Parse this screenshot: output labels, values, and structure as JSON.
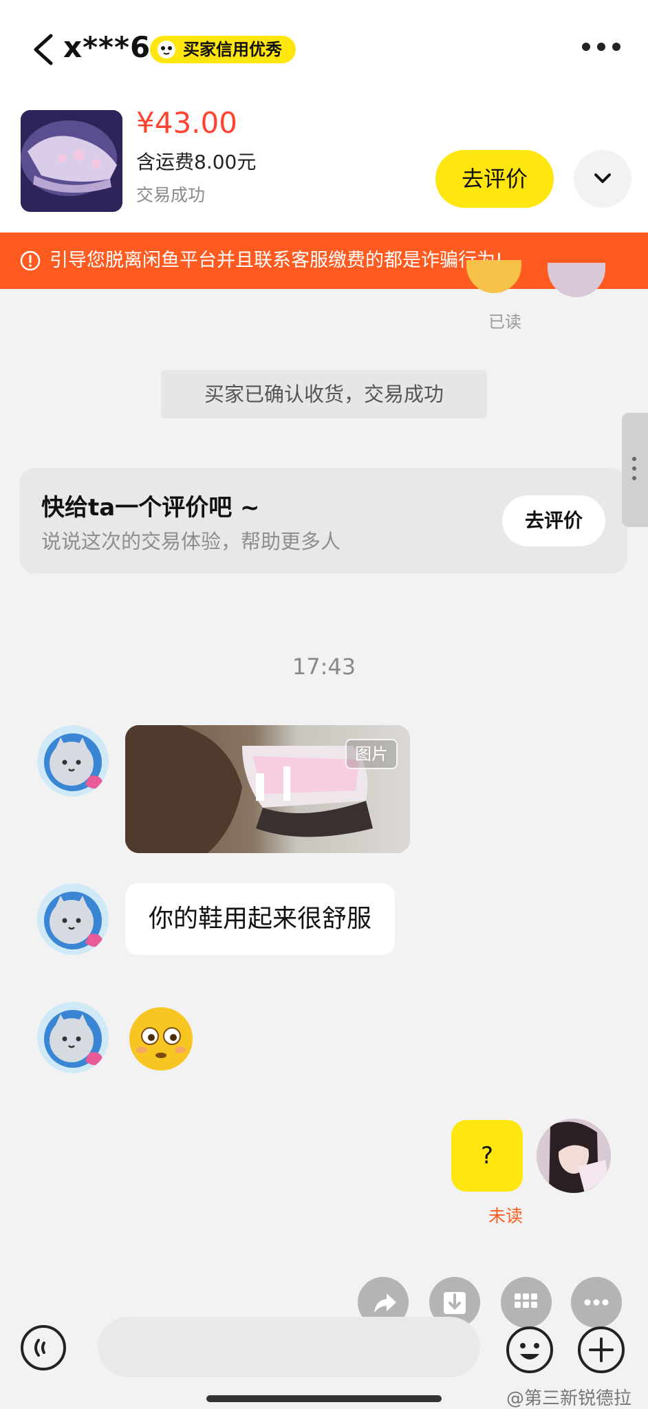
{
  "header": {
    "contact_name": "x***6",
    "credit_badge": "买家信用优秀"
  },
  "product": {
    "price": "¥43.00",
    "shipping": "含运费8.00元",
    "status": "交易成功",
    "review_button": "去评价"
  },
  "warning_banner": "引导您脱离闲鱼平台并且联系客服缴费的都是诈骗行为!",
  "chat": {
    "read_label": "已读",
    "system_message": "买家已确认收货，交易成功",
    "review_card": {
      "title": "快给ta一个评价吧 ~",
      "subtitle": "说说这次的交易体验，帮助更多人",
      "button": "去评价"
    },
    "timestamp": "17:43",
    "image_tag": "图片",
    "text_message": "你的鞋用起来很舒服",
    "outgoing_message": "?",
    "unread_label": "未读"
  },
  "input": {
    "value": ""
  },
  "watermark": "@第三新锐德拉",
  "colors": {
    "accent_yellow": "#ffe60f",
    "warning_orange": "#ff5a1f",
    "price_red": "#ff4330"
  }
}
